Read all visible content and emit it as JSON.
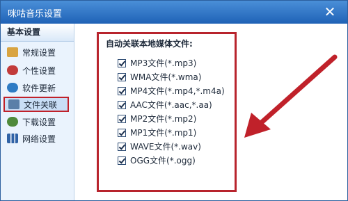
{
  "window": {
    "title": "咪咕音乐设置"
  },
  "sidebar": {
    "header": "基本设置",
    "items": [
      {
        "label": "常规设置",
        "icon": "pencil-paper-icon"
      },
      {
        "label": "个性设置",
        "icon": "people-icon"
      },
      {
        "label": "软件更新",
        "icon": "globe-icon"
      },
      {
        "label": "文件关联",
        "icon": "file-icon",
        "active": true
      },
      {
        "label": "下载设置",
        "icon": "gear-icon"
      },
      {
        "label": "网络设置",
        "icon": "network-bars-icon"
      }
    ]
  },
  "associations": {
    "title": "自动关联本地媒体文件:",
    "options": [
      {
        "label": "MP3文件(*.mp3)",
        "checked": true
      },
      {
        "label": "WMA文件(*.wma)",
        "checked": true
      },
      {
        "label": "MP4文件(*.mp4,*.m4a)",
        "checked": true
      },
      {
        "label": "AAC文件(*.aac,*.aa)",
        "checked": true
      },
      {
        "label": "MP2文件(*.mp2)",
        "checked": true
      },
      {
        "label": "MP1文件(*.mp1)",
        "checked": true
      },
      {
        "label": "WAVE文件(*.wav)",
        "checked": true
      },
      {
        "label": "OGG文件(*.ogg)",
        "checked": true
      }
    ]
  },
  "colors": {
    "highlight_red": "#c0212a",
    "titlebar_blue": "#1f62b6"
  }
}
